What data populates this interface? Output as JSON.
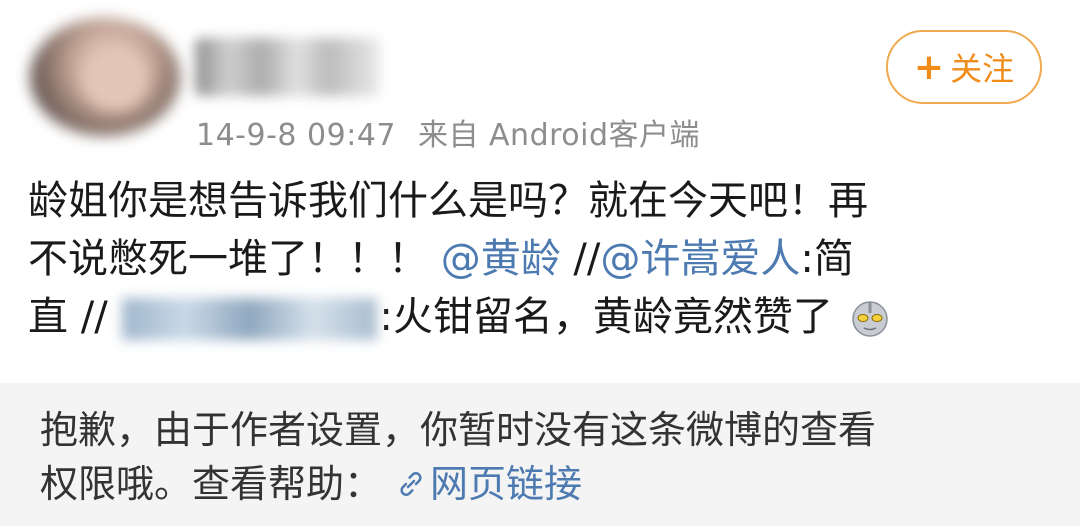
{
  "post": {
    "timestamp": "14-9-8 09:47",
    "source": "来自 Android客户端",
    "follow_label": "关注",
    "follow_plus": "+",
    "content": {
      "line1": "龄姐你是想告诉我们什么是吗？就在今天吧！再",
      "line2_text": "不说憋死一堆了！！！",
      "mention1": "@黄龄",
      "sep1": " //",
      "mention2": "@许嵩爱人",
      "line2_tail": ":简",
      "line3_head": "直 //",
      "line3_text": ":火钳留名，黄龄竟然赞了"
    },
    "emoji_icon": "ultraman-emoji-icon"
  },
  "notice": {
    "line1": "抱歉，由于作者设置，你暂时没有这条微博的查看",
    "line2_text": "权限哦。查看帮助：",
    "link_icon": "link-icon",
    "link_label": "网页链接"
  },
  "colors": {
    "link": "#4d7ab0",
    "follow_accent": "#f08c1a",
    "notice_bg": "#f4f4f4",
    "meta_text": "#8d8d8d"
  }
}
